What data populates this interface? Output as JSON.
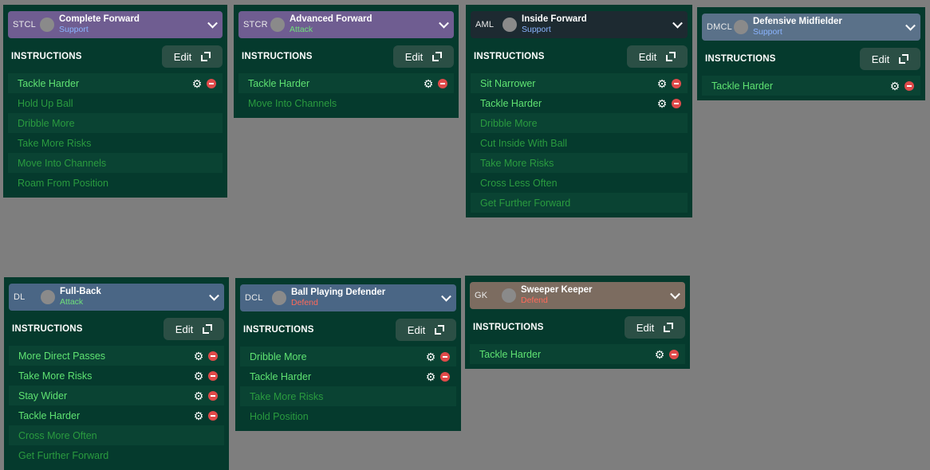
{
  "colors": {
    "background": "#7e7e7e",
    "card": "#053a2d",
    "active_text": "#5fe372",
    "inactive_text": "#2a9b3f",
    "support": "#8ab4ff",
    "attack": "#6fe07a",
    "defend": "#ff6a5a"
  },
  "labels": {
    "instructions": "INSTRUCTIONS",
    "edit": "Edit"
  },
  "cards": [
    {
      "position": "STCL",
      "role": "Complete Forward",
      "duty": "Support",
      "bar_color": "purple",
      "items": [
        {
          "label": "Tackle Harder",
          "active": true
        },
        {
          "label": "Hold Up Ball",
          "active": false
        },
        {
          "label": "Dribble More",
          "active": false
        },
        {
          "label": "Take More Risks",
          "active": false
        },
        {
          "label": "Move Into Channels",
          "active": false
        },
        {
          "label": "Roam From Position",
          "active": false
        }
      ]
    },
    {
      "position": "STCR",
      "role": "Advanced Forward",
      "duty": "Attack",
      "bar_color": "purple",
      "items": [
        {
          "label": "Tackle Harder",
          "active": true
        },
        {
          "label": "Move Into Channels",
          "active": false
        }
      ]
    },
    {
      "position": "AML",
      "role": "Inside Forward",
      "duty": "Support",
      "bar_color": "dark",
      "items": [
        {
          "label": "Sit Narrower",
          "active": true
        },
        {
          "label": "Tackle Harder",
          "active": true
        },
        {
          "label": "Dribble More",
          "active": false
        },
        {
          "label": "Cut Inside With Ball",
          "active": false
        },
        {
          "label": "Take More Risks",
          "active": false
        },
        {
          "label": "Cross Less Often",
          "active": false
        },
        {
          "label": "Get Further Forward",
          "active": false
        }
      ]
    },
    {
      "position": "DMCL",
      "role": "Defensive Midfielder",
      "duty": "Support",
      "bar_color": "slate",
      "items": [
        {
          "label": "Tackle Harder",
          "active": true
        }
      ]
    },
    {
      "position": "DL",
      "role": "Full-Back",
      "duty": "Attack",
      "bar_color": "blue",
      "items": [
        {
          "label": "More Direct Passes",
          "active": true
        },
        {
          "label": "Take More Risks",
          "active": true
        },
        {
          "label": "Stay Wider",
          "active": true
        },
        {
          "label": "Tackle Harder",
          "active": true
        },
        {
          "label": "Cross More Often",
          "active": false
        },
        {
          "label": "Get Further Forward",
          "active": false
        }
      ]
    },
    {
      "position": "DCL",
      "role": "Ball Playing Defender",
      "duty": "Defend",
      "bar_color": "blue",
      "items": [
        {
          "label": "Dribble More",
          "active": true
        },
        {
          "label": "Tackle Harder",
          "active": true
        },
        {
          "label": "Take More Risks",
          "active": false
        },
        {
          "label": "Hold Position",
          "active": false
        }
      ]
    },
    {
      "position": "GK",
      "role": "Sweeper Keeper",
      "duty": "Defend",
      "bar_color": "brown",
      "items": [
        {
          "label": "Tackle Harder",
          "active": true
        }
      ]
    }
  ]
}
